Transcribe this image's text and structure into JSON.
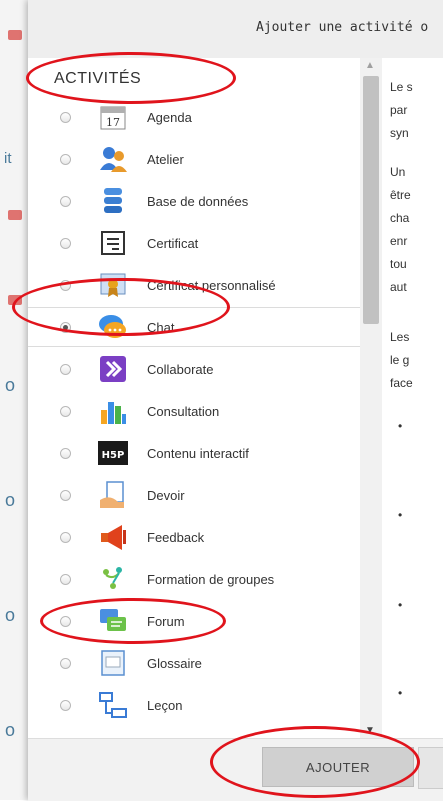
{
  "dialog": {
    "title": "Ajouter une activité o"
  },
  "section_title": "ACTIVITÉS",
  "activities": [
    {
      "label": "Agenda",
      "icon": "calendar-icon",
      "selected": false
    },
    {
      "label": "Atelier",
      "icon": "workshop-people-icon",
      "selected": false
    },
    {
      "label": "Base de données",
      "icon": "database-icon",
      "selected": false
    },
    {
      "label": "Certificat",
      "icon": "certificate-icon",
      "selected": false
    },
    {
      "label": "Certificat personnalisé",
      "icon": "custom-certificate-icon",
      "selected": false
    },
    {
      "label": "Chat",
      "icon": "chat-bubble-icon",
      "selected": true
    },
    {
      "label": "Collaborate",
      "icon": "collaborate-icon",
      "selected": false
    },
    {
      "label": "Consultation",
      "icon": "bar-chart-icon",
      "selected": false
    },
    {
      "label": "Contenu interactif",
      "icon": "h5p-icon",
      "selected": false
    },
    {
      "label": "Devoir",
      "icon": "assignment-icon",
      "selected": false
    },
    {
      "label": "Feedback",
      "icon": "megaphone-icon",
      "selected": false
    },
    {
      "label": "Formation de groupes",
      "icon": "group-formation-icon",
      "selected": false
    },
    {
      "label": "Forum",
      "icon": "forum-icon",
      "selected": false
    },
    {
      "label": "Glossaire",
      "icon": "glossary-icon",
      "selected": false
    },
    {
      "label": "Leçon",
      "icon": "lesson-icon",
      "selected": false
    }
  ],
  "calendar_day": "17",
  "h5p_text": "H5P",
  "description": {
    "lines": [
      "Le s",
      "par",
      "syn",
      "Un",
      "être",
      "cha",
      "enr",
      "tou",
      "aut",
      "Les",
      "le g",
      "face"
    ],
    "bullet": "•"
  },
  "background_page": {
    "marks": [
      "it",
      "o",
      "o",
      "o",
      "o"
    ]
  },
  "footer": {
    "add_label": "AJOUTER"
  },
  "colors": {
    "annotation": "#e0141c",
    "header_bg": "#eeeeee",
    "footer_bg": "#f2f2f2",
    "button_bg": "#d0d0d0"
  }
}
